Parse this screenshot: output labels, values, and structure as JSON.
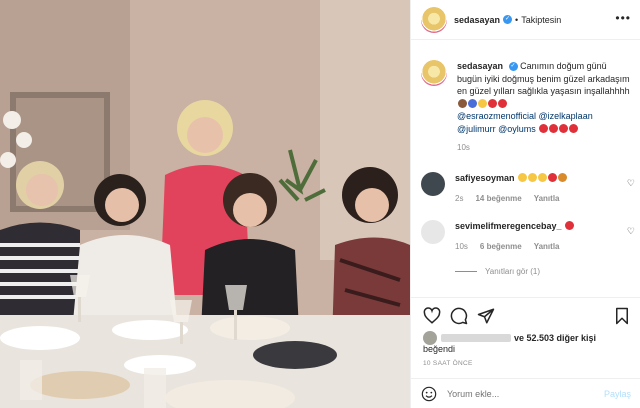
{
  "colors": {
    "link": "#00376b",
    "verified": "#3897f0",
    "muted": "#8e8e8e",
    "post_button": "#b2dffc"
  },
  "header": {
    "username": "sedasayan",
    "separator": "•",
    "follow_status": "Takiptesin",
    "more_icon": "ellipsis-icon"
  },
  "caption": {
    "username": "sedasayan",
    "text": "Canımın doğum günü bugün iyiki doğmuş benim güzel arkadaşım en güzel yılları sağlıkla yaşasın inşallahhhh",
    "mentions": [
      "@esraozmenofficial",
      "@izelkaplaan",
      "@julimurr",
      "@oylums"
    ],
    "time": "10s"
  },
  "comments": [
    {
      "username": "safiyesoyman",
      "time": "2s",
      "likes": "14 beğenme",
      "reply": "Yanıtla"
    },
    {
      "username": "sevimelifmeregencebay_",
      "time": "10s",
      "likes": "6 beğenme",
      "reply": "Yanıtla"
    }
  ],
  "view_replies": "Yanıtları gör (1)",
  "likes": {
    "text": "ve 52.503 diğer kişi",
    "line2": "beğendi"
  },
  "timestamp": "10 SAAT ÖNCE",
  "compose": {
    "placeholder": "Yorum ekle...",
    "post_label": "Paylaş"
  }
}
